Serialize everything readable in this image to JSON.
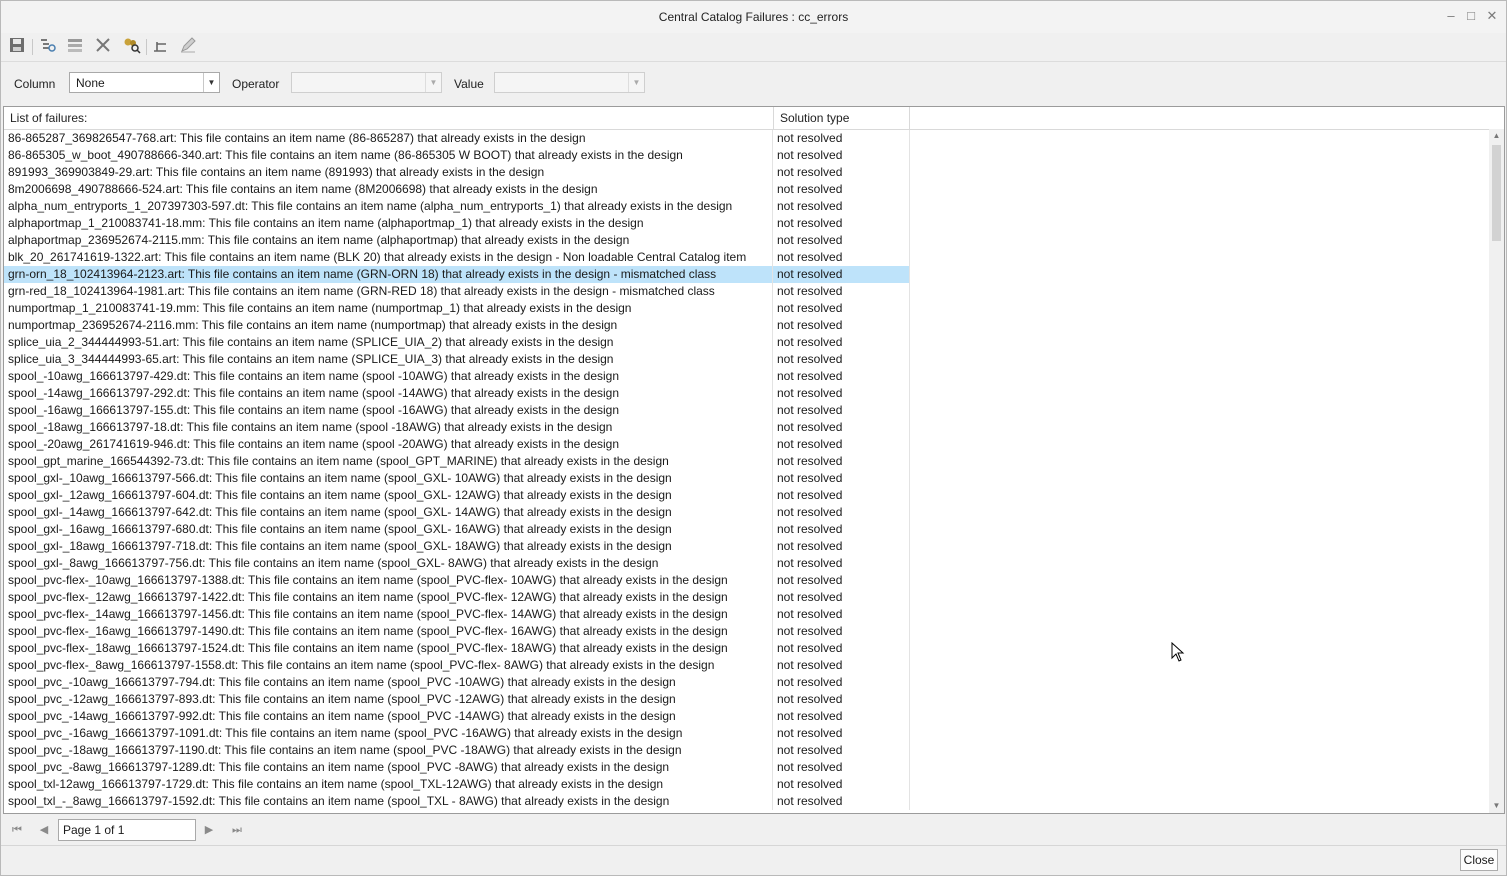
{
  "window": {
    "title": "Central Catalog Failures : cc_errors",
    "minimize_glyph": "–",
    "maximize_glyph": "□",
    "close_glyph": "✕"
  },
  "toolbar": {
    "icons": [
      "save-icon",
      "show-details-icon",
      "hide-details-icon",
      "delete-icon",
      "find-users-icon",
      "align-icon",
      "edit-icon"
    ]
  },
  "filter": {
    "column_label": "Column",
    "column_value": "None",
    "operator_label": "Operator",
    "operator_value": "",
    "value_label": "Value",
    "value_value": ""
  },
  "table": {
    "headers": [
      "List of failures:",
      "Solution type"
    ],
    "selected_index": 8,
    "rows": [
      {
        "failure": "86-865287_369826547-768.art: This file contains an item name (86-865287) that already exists in the design",
        "solution": "not resolved"
      },
      {
        "failure": "86-865305_w_boot_490788666-340.art: This file contains an item name (86-865305 W BOOT) that already exists in the design",
        "solution": "not resolved"
      },
      {
        "failure": "891993_369903849-29.art: This file contains an item name (891993) that already exists in the design",
        "solution": "not resolved"
      },
      {
        "failure": "8m2006698_490788666-524.art: This file contains an item name (8M2006698) that already exists in the design",
        "solution": "not resolved"
      },
      {
        "failure": "alpha_num_entryports_1_207397303-597.dt: This file contains an item name (alpha_num_entryports_1) that already exists in the design",
        "solution": "not resolved"
      },
      {
        "failure": "alphaportmap_1_210083741-18.mm: This file contains an item name (alphaportmap_1) that already exists in the design",
        "solution": "not resolved"
      },
      {
        "failure": "alphaportmap_236952674-2115.mm: This file contains an item name (alphaportmap) that already exists in the design",
        "solution": "not resolved"
      },
      {
        "failure": "blk_20_261741619-1322.art: This file contains an item name (BLK 20) that already exists in the design - Non loadable Central Catalog item",
        "solution": "not resolved"
      },
      {
        "failure": "grn-orn_18_102413964-2123.art: This file contains an item name (GRN-ORN 18) that already exists in the design - mismatched class",
        "solution": "not resolved"
      },
      {
        "failure": "grn-red_18_102413964-1981.art: This file contains an item name (GRN-RED 18) that already exists in the design - mismatched class",
        "solution": "not resolved"
      },
      {
        "failure": "numportmap_1_210083741-19.mm: This file contains an item name (numportmap_1) that already exists in the design",
        "solution": "not resolved"
      },
      {
        "failure": "numportmap_236952674-2116.mm: This file contains an item name (numportmap) that already exists in the design",
        "solution": "not resolved"
      },
      {
        "failure": "splice_uia_2_344444993-51.art: This file contains an item name (SPLICE_UIA_2) that already exists in the design",
        "solution": "not resolved"
      },
      {
        "failure": "splice_uia_3_344444993-65.art: This file contains an item name (SPLICE_UIA_3) that already exists in the design",
        "solution": "not resolved"
      },
      {
        "failure": "spool_-10awg_166613797-429.dt: This file contains an item name (spool -10AWG) that already exists in the design",
        "solution": "not resolved"
      },
      {
        "failure": "spool_-14awg_166613797-292.dt: This file contains an item name (spool -14AWG) that already exists in the design",
        "solution": "not resolved"
      },
      {
        "failure": "spool_-16awg_166613797-155.dt: This file contains an item name (spool -16AWG) that already exists in the design",
        "solution": "not resolved"
      },
      {
        "failure": "spool_-18awg_166613797-18.dt: This file contains an item name (spool -18AWG) that already exists in the design",
        "solution": "not resolved"
      },
      {
        "failure": "spool_-20awg_261741619-946.dt: This file contains an item name (spool -20AWG) that already exists in the design",
        "solution": "not resolved"
      },
      {
        "failure": "spool_gpt_marine_166544392-73.dt: This file contains an item name (spool_GPT_MARINE) that already exists in the design",
        "solution": "not resolved"
      },
      {
        "failure": "spool_gxl-_10awg_166613797-566.dt: This file contains an item name (spool_GXL- 10AWG) that already exists in the design",
        "solution": "not resolved"
      },
      {
        "failure": "spool_gxl-_12awg_166613797-604.dt: This file contains an item name (spool_GXL- 12AWG) that already exists in the design",
        "solution": "not resolved"
      },
      {
        "failure": "spool_gxl-_14awg_166613797-642.dt: This file contains an item name (spool_GXL- 14AWG) that already exists in the design",
        "solution": "not resolved"
      },
      {
        "failure": "spool_gxl-_16awg_166613797-680.dt: This file contains an item name (spool_GXL- 16AWG) that already exists in the design",
        "solution": "not resolved"
      },
      {
        "failure": "spool_gxl-_18awg_166613797-718.dt: This file contains an item name (spool_GXL- 18AWG) that already exists in the design",
        "solution": "not resolved"
      },
      {
        "failure": "spool_gxl-_8awg_166613797-756.dt: This file contains an item name (spool_GXL- 8AWG) that already exists in the design",
        "solution": "not resolved"
      },
      {
        "failure": "spool_pvc-flex-_10awg_166613797-1388.dt: This file contains an item name (spool_PVC-flex- 10AWG) that already exists in the design",
        "solution": "not resolved"
      },
      {
        "failure": "spool_pvc-flex-_12awg_166613797-1422.dt: This file contains an item name (spool_PVC-flex- 12AWG) that already exists in the design",
        "solution": "not resolved"
      },
      {
        "failure": "spool_pvc-flex-_14awg_166613797-1456.dt: This file contains an item name (spool_PVC-flex- 14AWG) that already exists in the design",
        "solution": "not resolved"
      },
      {
        "failure": "spool_pvc-flex-_16awg_166613797-1490.dt: This file contains an item name (spool_PVC-flex- 16AWG) that already exists in the design",
        "solution": "not resolved"
      },
      {
        "failure": "spool_pvc-flex-_18awg_166613797-1524.dt: This file contains an item name (spool_PVC-flex- 18AWG) that already exists in the design",
        "solution": "not resolved"
      },
      {
        "failure": "spool_pvc-flex-_8awg_166613797-1558.dt: This file contains an item name (spool_PVC-flex- 8AWG) that already exists in the design",
        "solution": "not resolved"
      },
      {
        "failure": "spool_pvc_-10awg_166613797-794.dt: This file contains an item name (spool_PVC -10AWG) that already exists in the design",
        "solution": "not resolved"
      },
      {
        "failure": "spool_pvc_-12awg_166613797-893.dt: This file contains an item name (spool_PVC -12AWG) that already exists in the design",
        "solution": "not resolved"
      },
      {
        "failure": "spool_pvc_-14awg_166613797-992.dt: This file contains an item name (spool_PVC -14AWG) that already exists in the design",
        "solution": "not resolved"
      },
      {
        "failure": "spool_pvc_-16awg_166613797-1091.dt: This file contains an item name (spool_PVC -16AWG) that already exists in the design",
        "solution": "not resolved"
      },
      {
        "failure": "spool_pvc_-18awg_166613797-1190.dt: This file contains an item name (spool_PVC -18AWG) that already exists in the design",
        "solution": "not resolved"
      },
      {
        "failure": "spool_pvc_-8awg_166613797-1289.dt: This file contains an item name (spool_PVC -8AWG) that already exists in the design",
        "solution": "not resolved"
      },
      {
        "failure": "spool_txl-12awg_166613797-1729.dt: This file contains an item name (spool_TXL-12AWG) that already exists in the design",
        "solution": "not resolved"
      },
      {
        "failure": "spool_txl_-_8awg_166613797-1592.dt: This file contains an item name (spool_TXL - 8AWG) that already exists in the design",
        "solution": "not resolved"
      }
    ]
  },
  "pager": {
    "page_text": "Page 1 of 1"
  },
  "footer": {
    "close_label": "Close"
  },
  "colors": {
    "selected_row": "#bee3fa",
    "window_bg": "#f0f0f0"
  }
}
